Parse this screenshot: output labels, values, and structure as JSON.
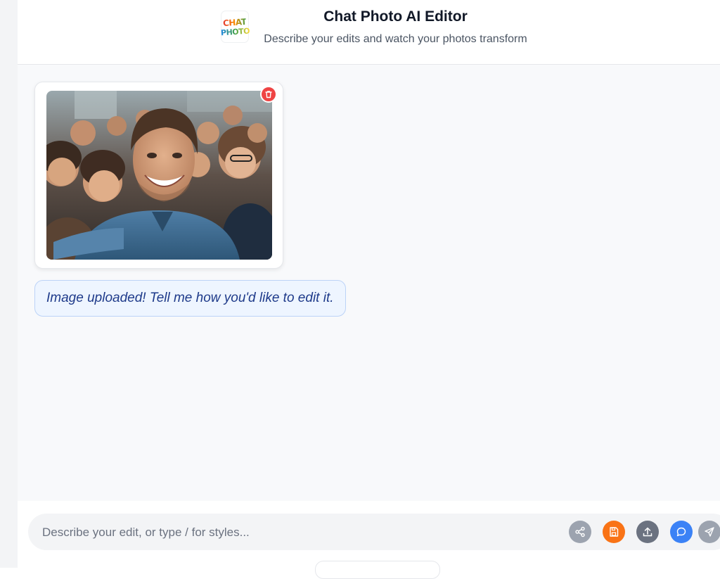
{
  "header": {
    "logo_line1": "CHAT",
    "logo_line2": "PHOTO",
    "title": "Chat Photo AI Editor",
    "subtitle": "Describe your edits and watch your photos transform"
  },
  "chat": {
    "image_alt": "uploaded selfie photo",
    "status_message": "Image uploaded! Tell me how you'd like to edit it."
  },
  "composer": {
    "placeholder": "Describe your edit, or type / for styles...",
    "value": "",
    "buttons": {
      "share": "share-icon",
      "save": "save-icon",
      "upload": "upload-icon",
      "chat": "chat-bubble-icon",
      "send": "send-icon"
    }
  },
  "colors": {
    "delete": "#ef4444",
    "save": "#f97316",
    "chat": "#3b82f6",
    "upload": "#6b7280",
    "share": "#9ca3af",
    "bubble_bg": "#eef5ff",
    "bubble_text": "#1e3a8a"
  }
}
